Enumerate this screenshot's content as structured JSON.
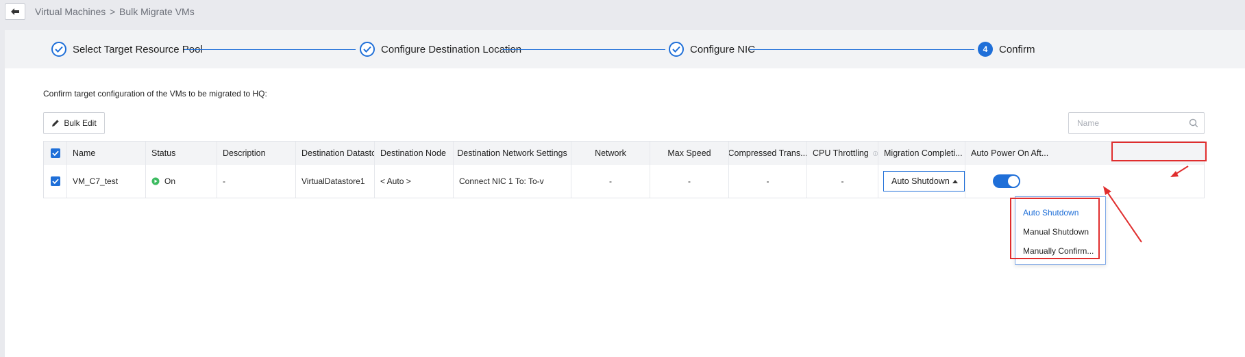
{
  "breadcrumb": {
    "root": "Virtual Machines",
    "separator": ">",
    "current": "Bulk Migrate VMs"
  },
  "steps": [
    {
      "label": "Select Target Resource Pool",
      "state": "done"
    },
    {
      "label": "Configure Destination Location",
      "state": "done"
    },
    {
      "label": "Configure NIC",
      "state": "done"
    },
    {
      "label": "Confirm",
      "state": "current",
      "number": "4"
    }
  ],
  "intro": "Confirm target configuration of the VMs to be migrated to HQ:",
  "toolbar": {
    "bulk_edit_label": "Bulk Edit",
    "search_placeholder": "Name"
  },
  "table": {
    "headers": [
      "Name",
      "Status",
      "Description",
      "Destination Datastore",
      "Destination Node",
      "Destination Network Settings",
      "Network",
      "Max Speed",
      "Compressed Trans...",
      "CPU Throttling",
      "Migration Completi...",
      "Auto Power On Aft..."
    ],
    "rows": [
      {
        "name": "VM_C7_test",
        "status": "On",
        "description": "-",
        "datastore": "VirtualDatastore1",
        "node": "< Auto >",
        "network_settings": "Connect NIC 1 To: To-v",
        "network": "-",
        "max_speed": "-",
        "compressed": "-",
        "cpu_throttling": "-",
        "migration_completion": "Auto Shutdown",
        "auto_power_on": true
      }
    ]
  },
  "dropdown": {
    "options": [
      "Auto Shutdown",
      "Manual Shutdown",
      "Manually Confirm..."
    ],
    "selected": "Auto Shutdown"
  },
  "colors": {
    "accent": "#1f6fd8",
    "annotation": "#e02d2d",
    "status_on": "#3dbb61"
  }
}
